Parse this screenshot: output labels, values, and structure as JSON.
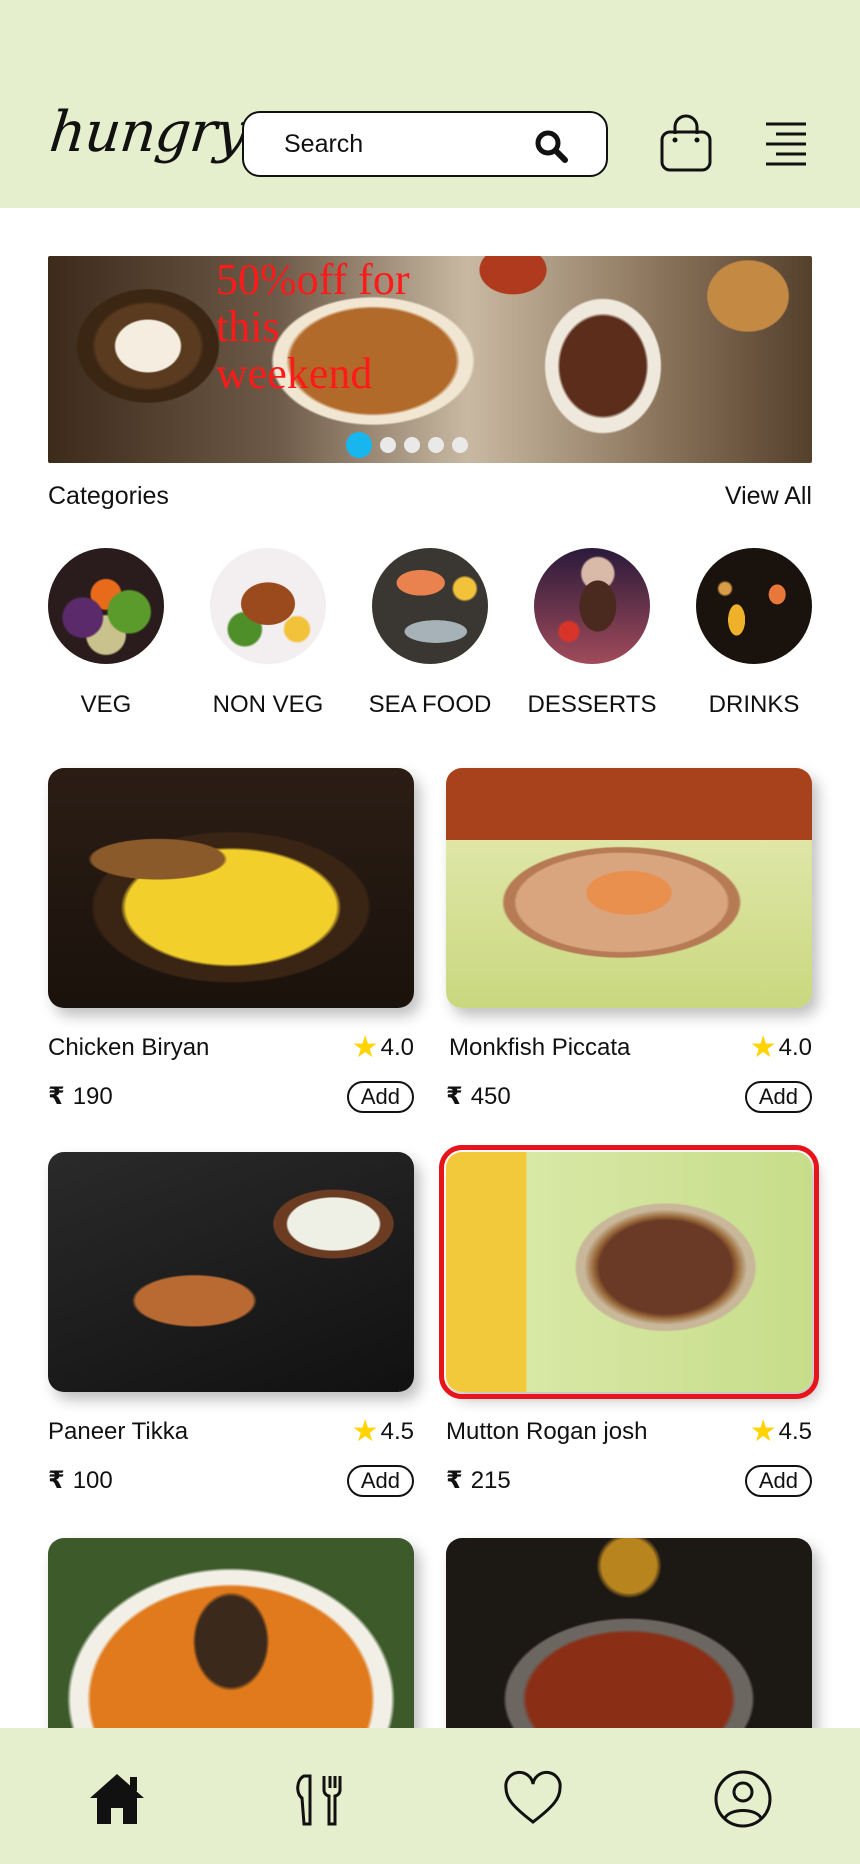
{
  "header": {
    "logo": "hungry",
    "search_placeholder": "Search",
    "icons": [
      "search-icon",
      "shopping-bag-icon",
      "menu-icon"
    ]
  },
  "banner": {
    "promo_text": "50%off for this weekend",
    "slide_count": 5,
    "active_slide": 1
  },
  "categories": {
    "title": "Categories",
    "view_all": "View All",
    "items": [
      {
        "label": "VEG"
      },
      {
        "label": "NON VEG"
      },
      {
        "label": "SEA FOOD"
      },
      {
        "label": "DESSERTS"
      },
      {
        "label": "DRINKS"
      }
    ]
  },
  "foods": [
    {
      "name": "Chicken Biryan",
      "rating": "4.0",
      "price": "190",
      "add": "Add"
    },
    {
      "name": "Monkfish Piccata",
      "rating": "4.0",
      "price": "450",
      "add": "Add"
    },
    {
      "name": "Paneer Tikka",
      "rating": "4.5",
      "price": "100",
      "add": "Add"
    },
    {
      "name": "Mutton Rogan josh",
      "rating": "4.5",
      "price": "215",
      "add": "Add"
    }
  ],
  "currency_symbol": "₹",
  "bottom_nav": [
    "home-icon",
    "restaurant-icon",
    "heart-icon",
    "profile-icon"
  ],
  "colors": {
    "header_bg": "#e6efcd",
    "accent_dot": "#18b6ef",
    "promo_red": "#ff1a1a",
    "star": "#ffd400",
    "selected_outline": "#e8141b"
  }
}
